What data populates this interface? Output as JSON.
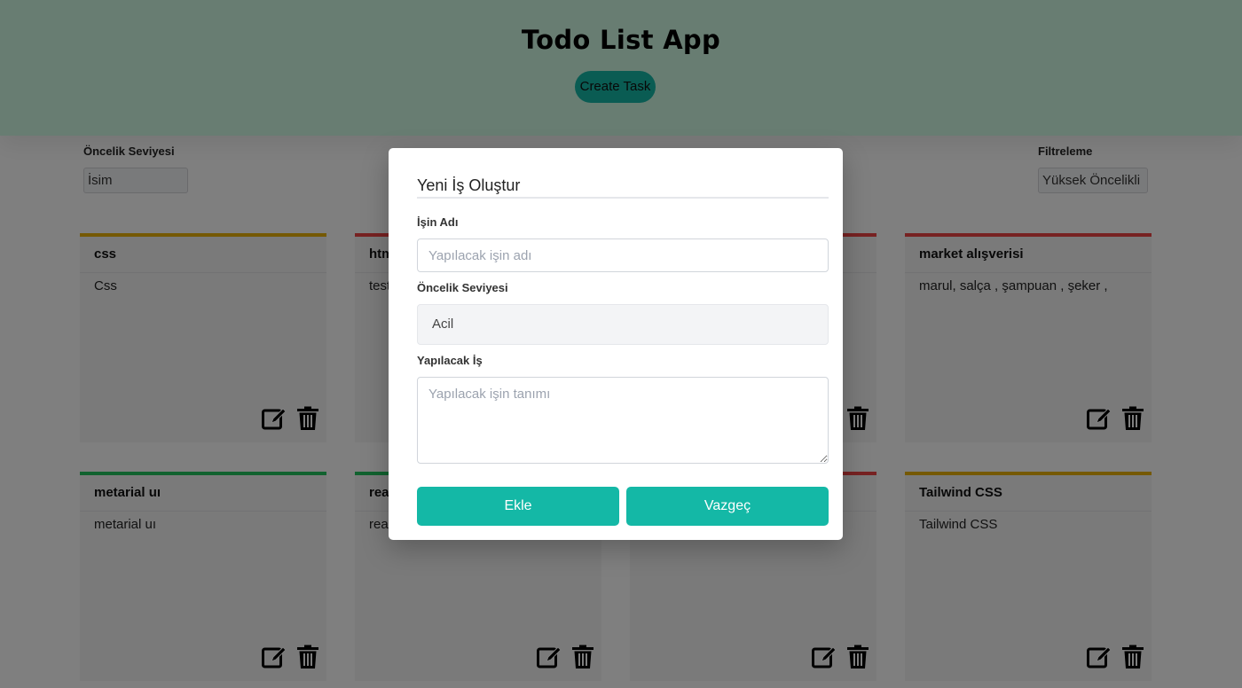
{
  "header": {
    "title": "Todo List App",
    "create_button": "Create Task"
  },
  "controls": {
    "priority_label": "Öncelik Seviyesi",
    "priority_value": "İsim",
    "filter_label": "Filtreleme",
    "filter_value": "Yüksek Öncelikli"
  },
  "cards": [
    {
      "title": "css",
      "description": "Css",
      "color": "yellow"
    },
    {
      "title": "html",
      "description": "test",
      "color": "red"
    },
    {
      "title": "",
      "description": "",
      "color": "red"
    },
    {
      "title": "market alışverisi",
      "description": "marul, salça , şampuan , şeker ,",
      "color": "red"
    },
    {
      "title": "metarial uı",
      "description": "metarial uı",
      "color": "green"
    },
    {
      "title": "react",
      "description": "react",
      "color": "green"
    },
    {
      "title": "",
      "description": "",
      "color": "red"
    },
    {
      "title": "Tailwind CSS",
      "description": "Tailwind CSS",
      "color": "yellow"
    }
  ],
  "modal": {
    "title": "Yeni İş Oluştur",
    "name_label": "İşin Adı",
    "name_placeholder": "Yapılacak işin adı",
    "priority_label": "Öncelik Seviyesi",
    "priority_value": "Acil",
    "task_label": "Yapılacak İş",
    "task_placeholder": "Yapılacak işin tanımı",
    "add_button": "Ekle",
    "cancel_button": "Vazgeç"
  },
  "colors": {
    "accent": "#14b8a6",
    "header_bg": "#d1fae5",
    "yellow": "#eab308",
    "red": "#ef4444",
    "green": "#22c55e"
  },
  "icons": [
    "edit-icon",
    "trash-icon"
  ]
}
